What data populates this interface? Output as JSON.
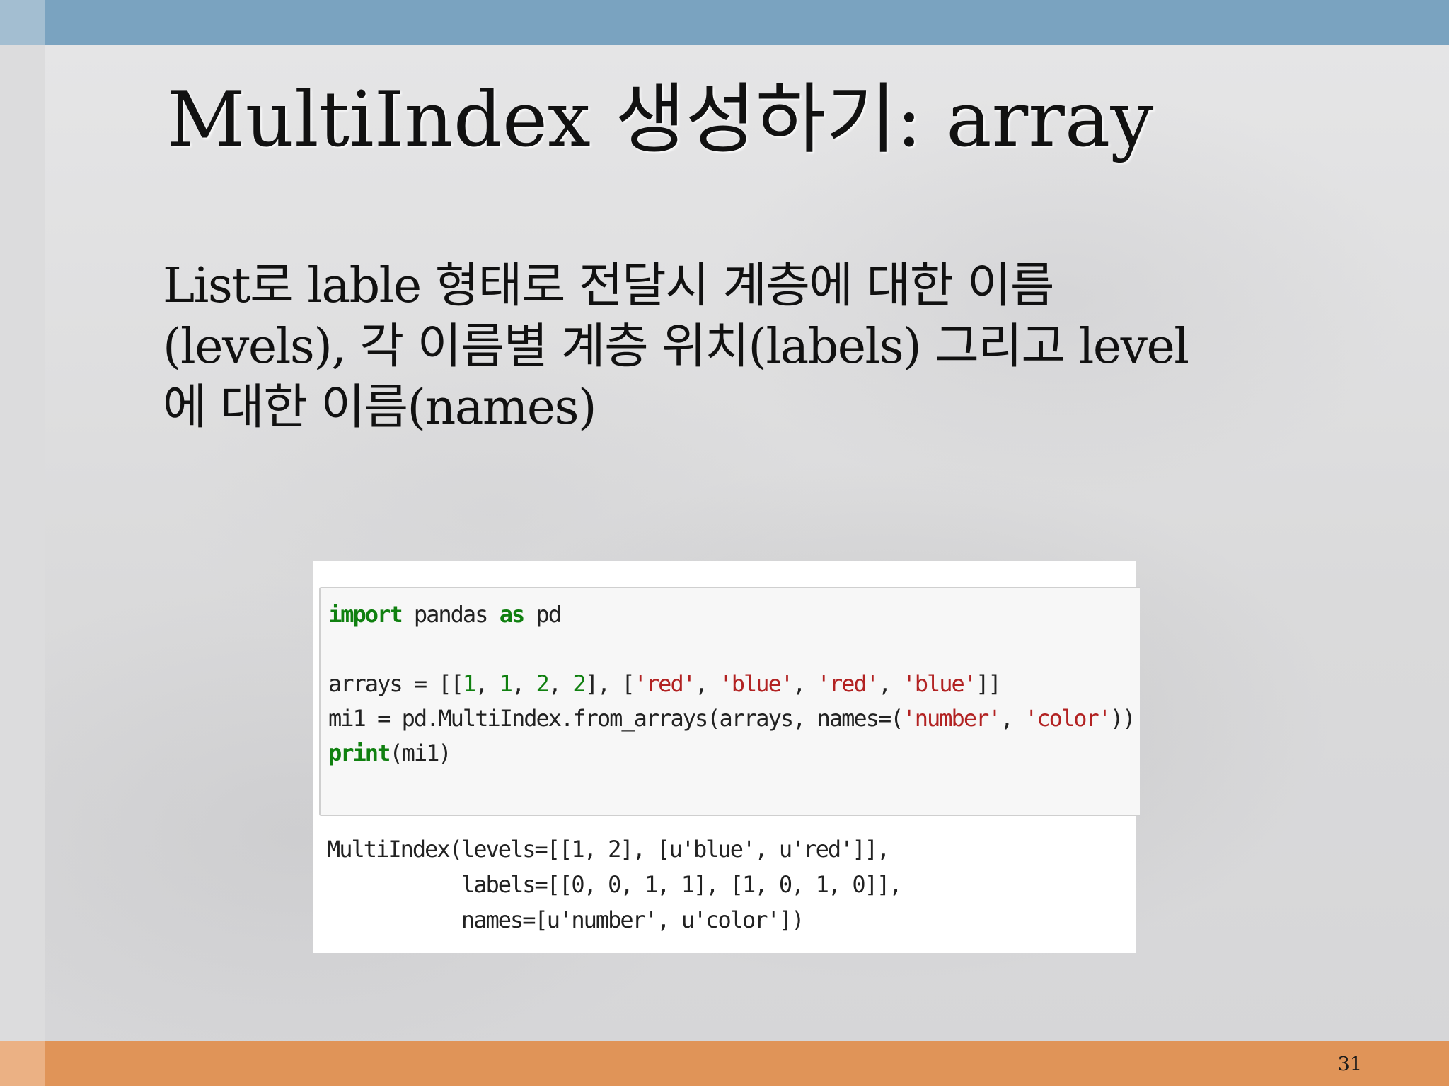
{
  "slide": {
    "title": "MultiIndex 생성하기: array",
    "body_lines": [
      "List로 lable 형태로 전달시 계층에 대한 이름",
      "(levels), 각 이름별 계층 위치(labels) 그리고 level",
      "에 대한 이름(names)"
    ],
    "page_number": "31"
  },
  "code": {
    "input": {
      "line1": {
        "kw_import": "import",
        "t1": " pandas ",
        "kw_as": "as",
        "t2": " pd"
      },
      "line3": {
        "t1": "arrays = [[",
        "n1": "1",
        "s1": ", ",
        "n2": "1",
        "s2": ", ",
        "n3": "2",
        "s3": ", ",
        "n4": "2",
        "t2": "], [",
        "str1": "'red'",
        "s4": ", ",
        "str2": "'blue'",
        "s5": ", ",
        "str3": "'red'",
        "s6": ", ",
        "str4": "'blue'",
        "t3": "]]"
      },
      "line4": {
        "t1": "mi1 = pd.MultiIndex.from_arrays(arrays, names=(",
        "str1": "'number'",
        "s1": ", ",
        "str2": "'color'",
        "t2": "))"
      },
      "line5": {
        "kw_print": "print",
        "t1": "(mi1)"
      }
    },
    "output": {
      "line1": "MultiIndex(levels=[[1, 2], [u'blue', u'red']],",
      "line2": "           labels=[[0, 0, 1, 1], [1, 0, 1, 0]],",
      "line3": "           names=[u'number', u'color'])"
    }
  },
  "colors": {
    "top_bar": "#7aa3c0",
    "bottom_bar": "#e09458",
    "keyword": "#108010",
    "string": "#b22222"
  }
}
